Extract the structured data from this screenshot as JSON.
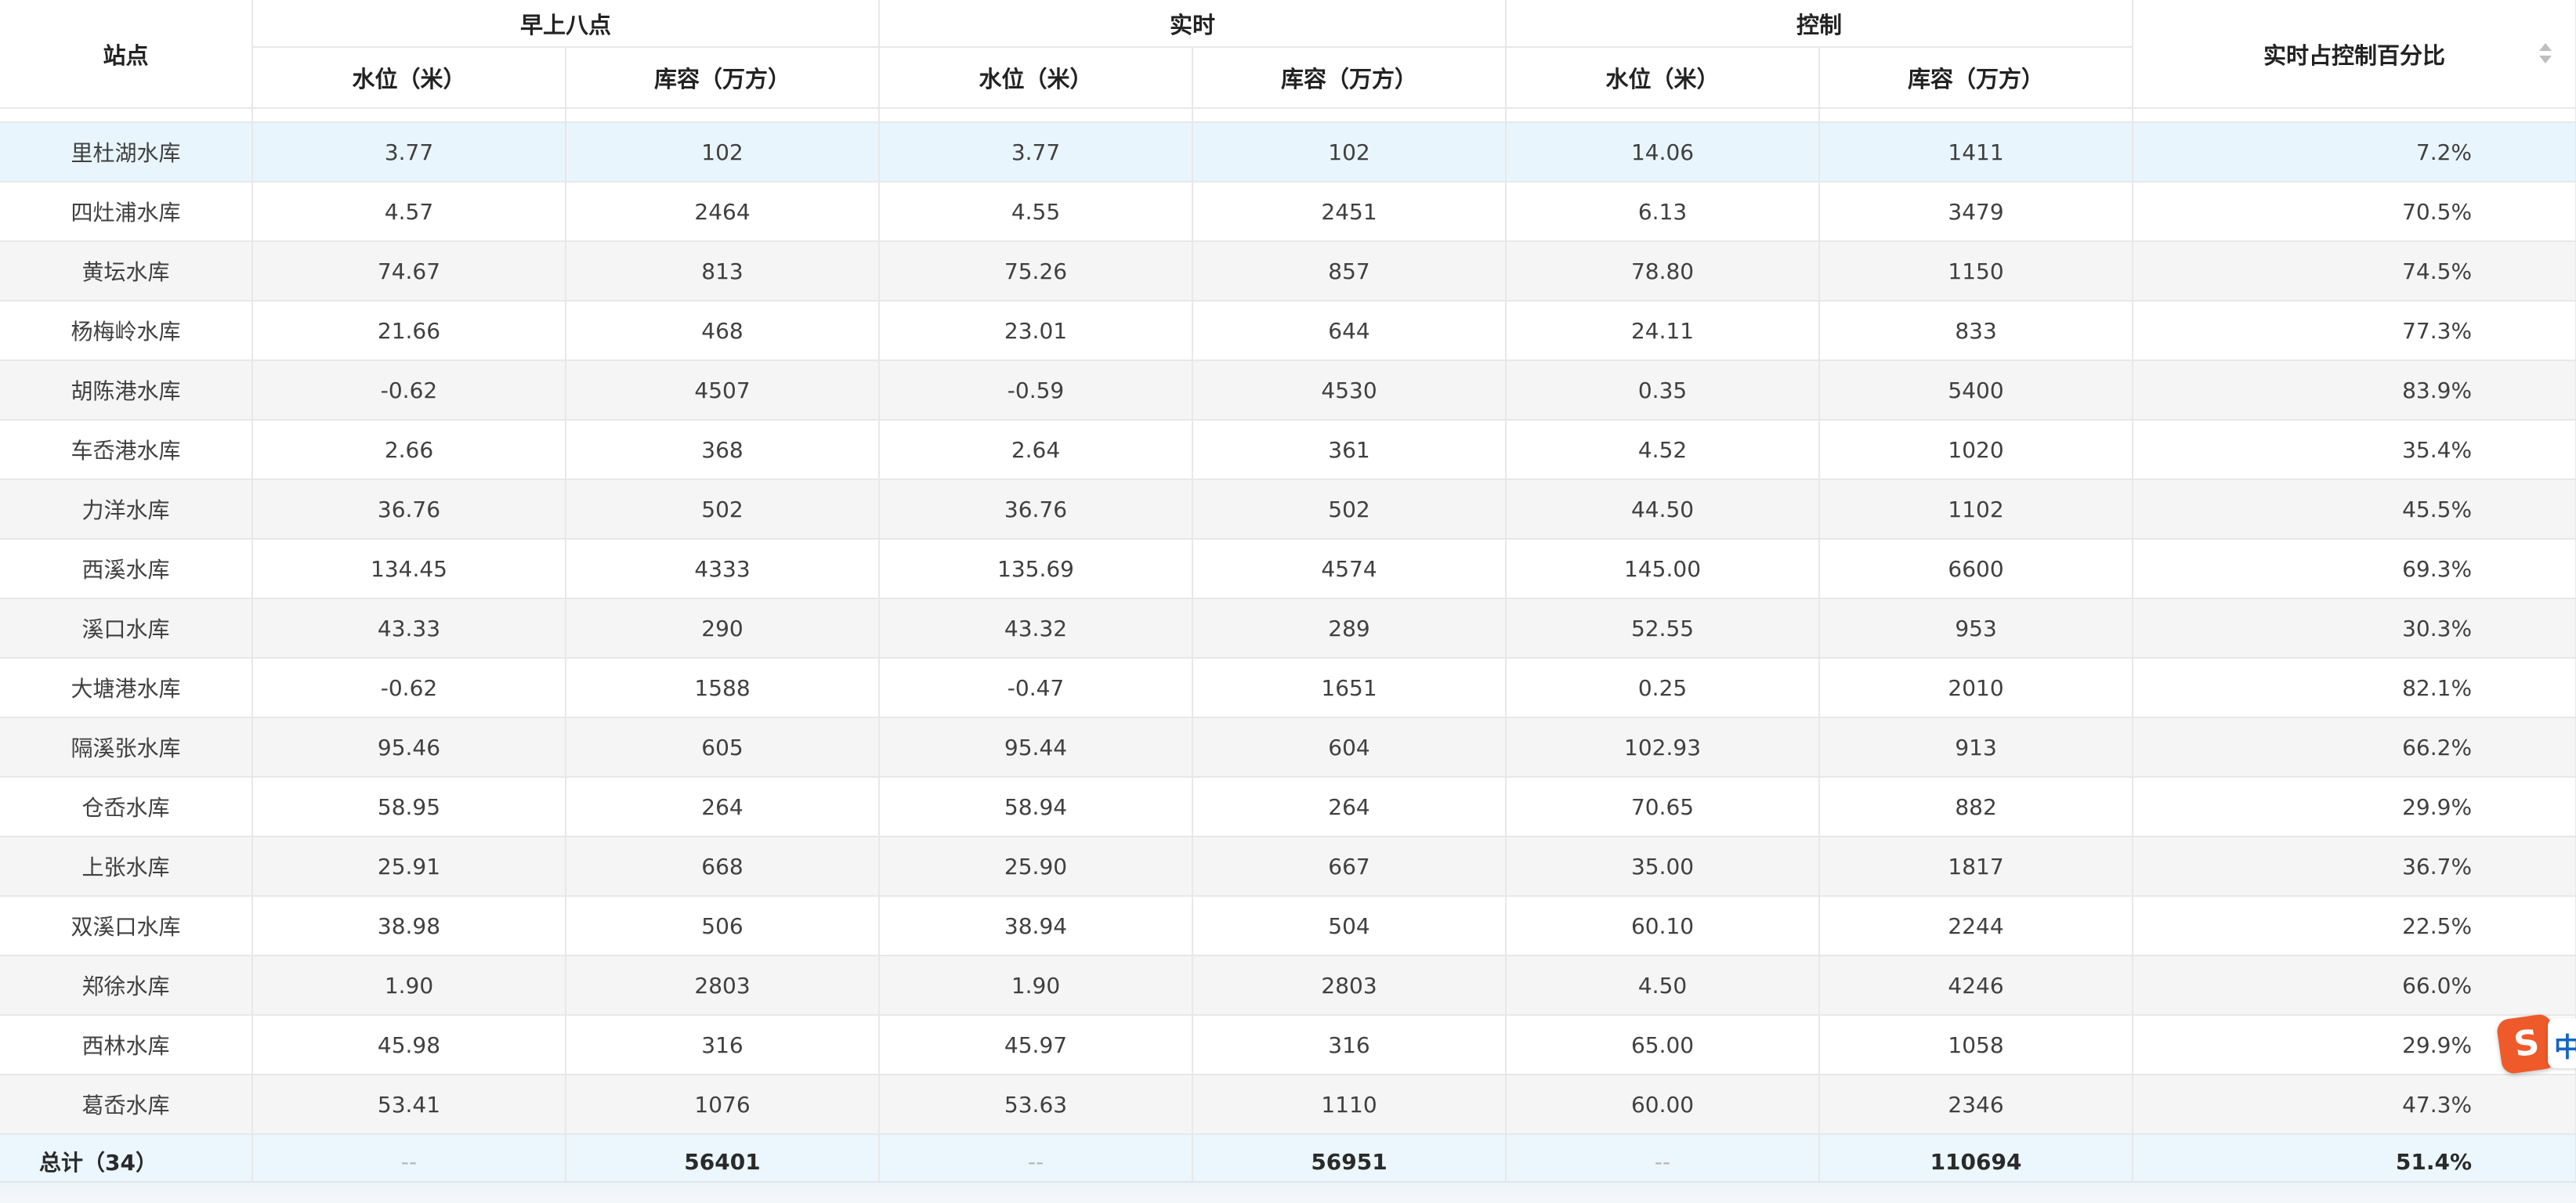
{
  "columns": {
    "station": "站点",
    "group_morning": "早上八点",
    "group_realtime": "实时",
    "group_control": "控制",
    "water_level": "水位（米）",
    "storage": "库容（万方）",
    "pct": "实时占控制百分比"
  },
  "rows": [
    {
      "name": "里杜湖水库",
      "m_level": "3.77",
      "m_storage": "102",
      "r_level": "3.77",
      "r_storage": "102",
      "c_level": "14.06",
      "c_storage": "1411",
      "pct": "7.2%"
    },
    {
      "name": "四灶浦水库",
      "m_level": "4.57",
      "m_storage": "2464",
      "r_level": "4.55",
      "r_storage": "2451",
      "c_level": "6.13",
      "c_storage": "3479",
      "pct": "70.5%"
    },
    {
      "name": "黄坛水库",
      "m_level": "74.67",
      "m_storage": "813",
      "r_level": "75.26",
      "r_storage": "857",
      "c_level": "78.80",
      "c_storage": "1150",
      "pct": "74.5%"
    },
    {
      "name": "杨梅岭水库",
      "m_level": "21.66",
      "m_storage": "468",
      "r_level": "23.01",
      "r_storage": "644",
      "c_level": "24.11",
      "c_storage": "833",
      "pct": "77.3%"
    },
    {
      "name": "胡陈港水库",
      "m_level": "-0.62",
      "m_storage": "4507",
      "r_level": "-0.59",
      "r_storage": "4530",
      "c_level": "0.35",
      "c_storage": "5400",
      "pct": "83.9%"
    },
    {
      "name": "车岙港水库",
      "m_level": "2.66",
      "m_storage": "368",
      "r_level": "2.64",
      "r_storage": "361",
      "c_level": "4.52",
      "c_storage": "1020",
      "pct": "35.4%"
    },
    {
      "name": "力洋水库",
      "m_level": "36.76",
      "m_storage": "502",
      "r_level": "36.76",
      "r_storage": "502",
      "c_level": "44.50",
      "c_storage": "1102",
      "pct": "45.5%"
    },
    {
      "name": "西溪水库",
      "m_level": "134.45",
      "m_storage": "4333",
      "r_level": "135.69",
      "r_storage": "4574",
      "c_level": "145.00",
      "c_storage": "6600",
      "pct": "69.3%"
    },
    {
      "name": "溪口水库",
      "m_level": "43.33",
      "m_storage": "290",
      "r_level": "43.32",
      "r_storage": "289",
      "c_level": "52.55",
      "c_storage": "953",
      "pct": "30.3%"
    },
    {
      "name": "大塘港水库",
      "m_level": "-0.62",
      "m_storage": "1588",
      "r_level": "-0.47",
      "r_storage": "1651",
      "c_level": "0.25",
      "c_storage": "2010",
      "pct": "82.1%"
    },
    {
      "name": "隔溪张水库",
      "m_level": "95.46",
      "m_storage": "605",
      "r_level": "95.44",
      "r_storage": "604",
      "c_level": "102.93",
      "c_storage": "913",
      "pct": "66.2%"
    },
    {
      "name": "仓岙水库",
      "m_level": "58.95",
      "m_storage": "264",
      "r_level": "58.94",
      "r_storage": "264",
      "c_level": "70.65",
      "c_storage": "882",
      "pct": "29.9%"
    },
    {
      "name": "上张水库",
      "m_level": "25.91",
      "m_storage": "668",
      "r_level": "25.90",
      "r_storage": "667",
      "c_level": "35.00",
      "c_storage": "1817",
      "pct": "36.7%"
    },
    {
      "name": "双溪口水库",
      "m_level": "38.98",
      "m_storage": "506",
      "r_level": "38.94",
      "r_storage": "504",
      "c_level": "60.10",
      "c_storage": "2244",
      "pct": "22.5%"
    },
    {
      "name": "郑徐水库",
      "m_level": "1.90",
      "m_storage": "2803",
      "r_level": "1.90",
      "r_storage": "2803",
      "c_level": "4.50",
      "c_storage": "4246",
      "pct": "66.0%"
    },
    {
      "name": "西林水库",
      "m_level": "45.98",
      "m_storage": "316",
      "r_level": "45.97",
      "r_storage": "316",
      "c_level": "65.00",
      "c_storage": "1058",
      "pct": "29.9%"
    },
    {
      "name": "葛岙水库",
      "m_level": "53.41",
      "m_storage": "1076",
      "r_level": "53.63",
      "r_storage": "1110",
      "c_level": "60.00",
      "c_storage": "2346",
      "pct": "47.3%"
    }
  ],
  "total": {
    "name": "总计（34）",
    "m_level": "--",
    "m_storage": "56401",
    "r_level": "--",
    "r_storage": "56951",
    "c_level": "--",
    "c_storage": "110694",
    "pct": "51.4%"
  },
  "ime": {
    "badge": "S",
    "label": "中"
  },
  "colors": {
    "highlight_row": "#e9f5fd",
    "stripe_row": "#f5f5f5",
    "total_row": "#ebf6fd",
    "ime_badge": "#ee5a2a"
  }
}
